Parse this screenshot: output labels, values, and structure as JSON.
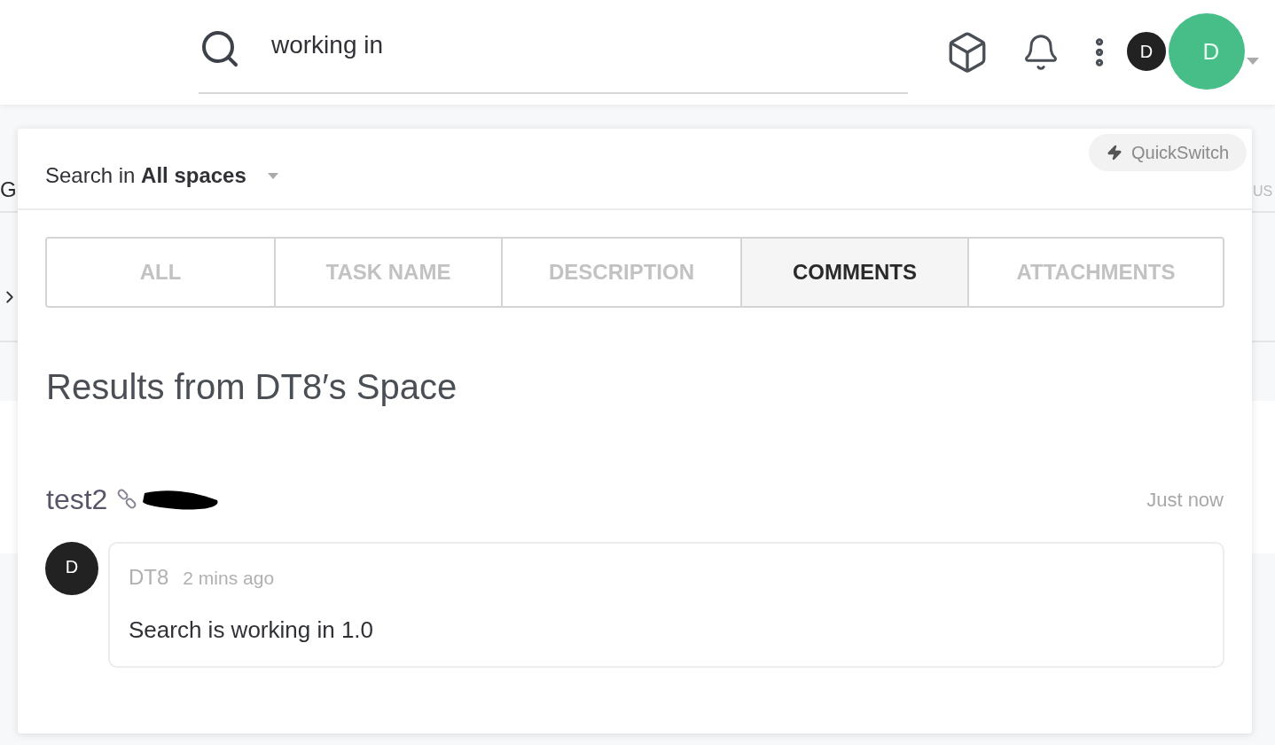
{
  "header": {
    "search": {
      "value": "working in"
    },
    "avatars": [
      {
        "initial": "D",
        "color": "#222222"
      },
      {
        "initial": "D",
        "color": "#47bd88"
      }
    ]
  },
  "background": {
    "heading_fragment": "G",
    "column_fragment": "US"
  },
  "panel": {
    "quickswitch": "QuickSwitch",
    "scope": {
      "prefix": "Search in",
      "value": "All spaces"
    },
    "tabs": [
      {
        "label": "ALL",
        "selected": false
      },
      {
        "label": "TASK NAME",
        "selected": false
      },
      {
        "label": "DESCRIPTION",
        "selected": false
      },
      {
        "label": "COMMENTS",
        "selected": true
      },
      {
        "label": "ATTACHMENTS",
        "selected": false
      }
    ],
    "section_title": "Results from DT8′s Space",
    "results": [
      {
        "title": "test2",
        "time": "Just now",
        "comments": [
          {
            "avatar": "D",
            "author": "DT8",
            "time": "2 mins ago",
            "text": "Search is working in 1.0"
          }
        ]
      }
    ]
  }
}
